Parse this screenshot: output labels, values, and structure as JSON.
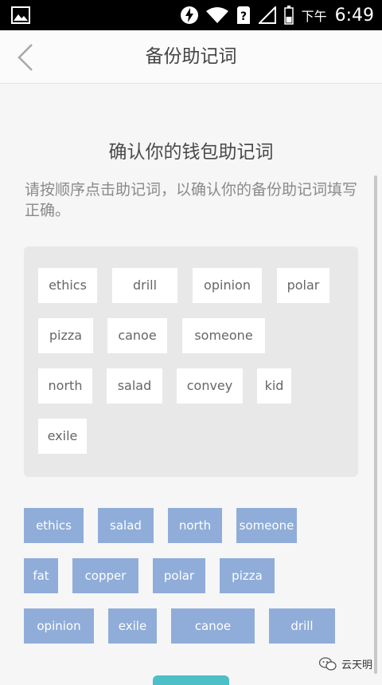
{
  "status_bar": {
    "period": "下午",
    "time": "6:49"
  },
  "header": {
    "title": "备份助记词"
  },
  "main": {
    "heading": "确认你的钱包助记词",
    "hint": "请按顺序点击助记词，以确认你的备份助记词填写正确。",
    "selected_words": [
      "ethics",
      "drill",
      "opinion",
      "polar",
      "pizza",
      "canoe",
      "someone",
      "north",
      "salad",
      "convey",
      "kid",
      "exile"
    ],
    "word_bank": [
      "ethics",
      "salad",
      "north",
      "someone",
      "fat",
      "copper",
      "polar",
      "pizza",
      "opinion",
      "exile",
      "canoe",
      "drill"
    ]
  },
  "watermark": {
    "text": "云天明"
  }
}
